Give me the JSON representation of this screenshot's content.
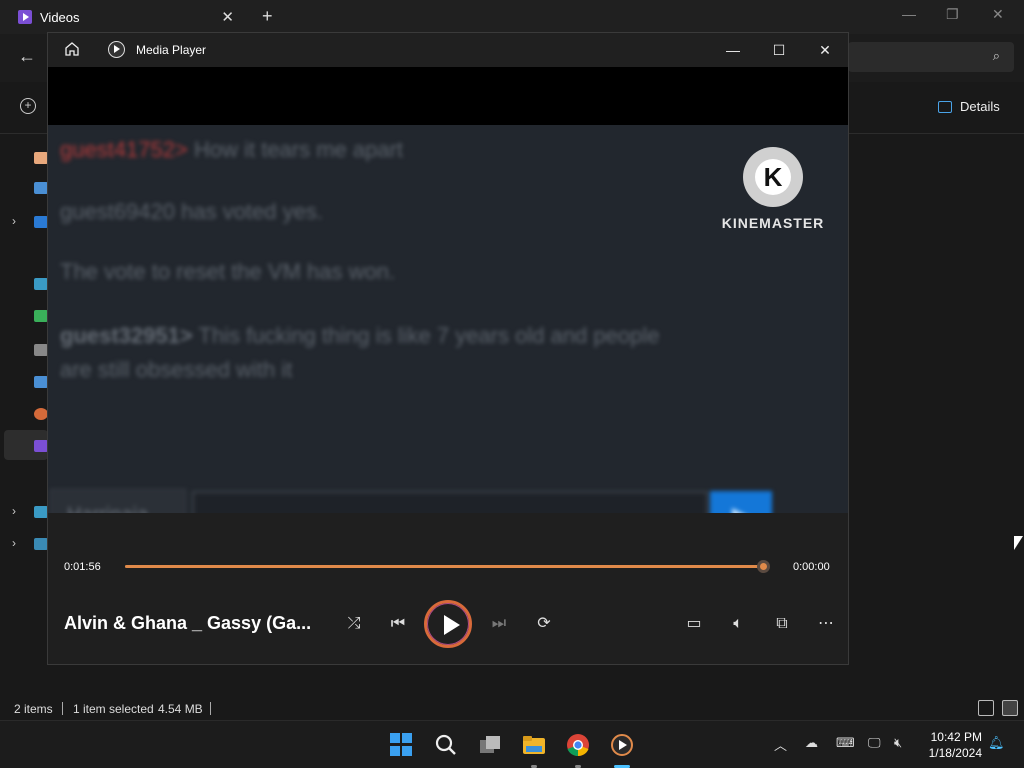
{
  "explorer": {
    "tab_title": "Videos",
    "details_label": "Details",
    "status": {
      "items": "2 items",
      "selected": "1 item selected",
      "size": "4.54 MB"
    }
  },
  "player": {
    "app_name": "Media Player",
    "video": {
      "chat_lines": [
        {
          "user": "guest41752>",
          "text": "How it tears me apart"
        },
        {
          "user": "",
          "text": "guest69420 has voted yes."
        },
        {
          "user": "",
          "text": "The vote to reset the VM has won."
        },
        {
          "user": "guest32951>",
          "text": "This fucking thing is like 7 years old and people"
        },
        {
          "user": "",
          "text": "are still obsessed with it"
        }
      ],
      "chat_name": "Harrinaia",
      "watermark_letter": "K",
      "watermark_text": "KINEMASTER"
    },
    "time_elapsed": "0:01:56",
    "time_remaining": "0:00:00",
    "progress": 1.0,
    "song_title": "Alvin & Ghana _ Gassy (Ga...",
    "accent_color": "#e08a4a"
  },
  "taskbar": {
    "time": "10:42 PM",
    "date": "1/18/2024"
  }
}
